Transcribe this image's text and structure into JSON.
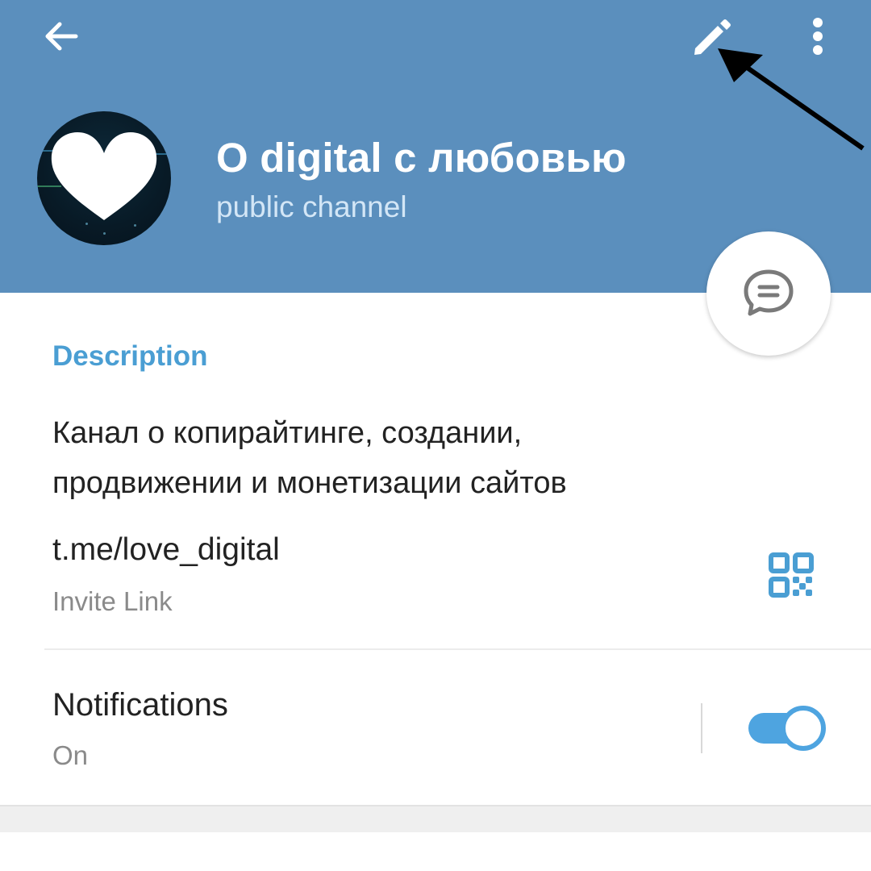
{
  "header": {
    "back_icon": "arrow-left-icon",
    "edit_icon": "pencil-icon",
    "more_icon": "more-vertical-icon",
    "background_color": "#5b8fbd"
  },
  "channel": {
    "title": "O digital с любовью",
    "subtitle": "public channel",
    "avatar_icon": "heart-icon"
  },
  "fab": {
    "icon": "message-icon"
  },
  "info": {
    "section_title": "Description",
    "description": "Канал о копирайтинге, создании, продвижении и монетизации сайтов",
    "link": {
      "value": "t.me/love_digital",
      "label": "Invite Link",
      "icon": "qr-code-icon"
    },
    "notifications": {
      "title": "Notifications",
      "value": "On",
      "enabled": true
    }
  },
  "colors": {
    "accent": "#4a9ed3",
    "toggle": "#4ea4e0",
    "primary_text": "#222222",
    "secondary_text": "#8a8a8a"
  },
  "annotation": {
    "type": "arrow",
    "points_to": "edit-button"
  }
}
